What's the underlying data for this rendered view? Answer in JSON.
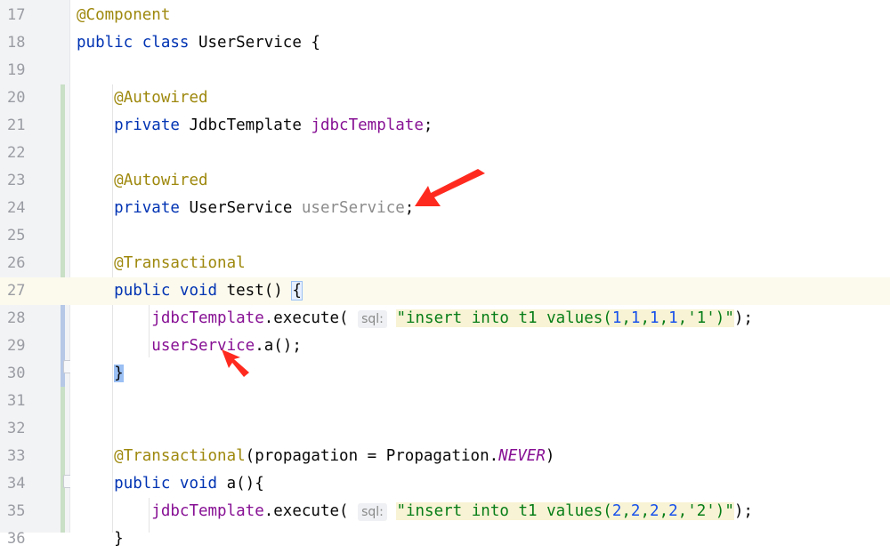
{
  "editor": {
    "lines": [
      {
        "n": "17",
        "parts": [
          {
            "t": "@Component",
            "c": "ann"
          }
        ]
      },
      {
        "n": "18",
        "parts": [
          {
            "t": "public",
            "c": "kw"
          },
          {
            "t": " "
          },
          {
            "t": "class",
            "c": "kw"
          },
          {
            "t": " UserService {"
          }
        ]
      },
      {
        "n": "19",
        "parts": []
      },
      {
        "n": "20",
        "parts": [
          {
            "t": "    "
          },
          {
            "t": "@Autowired",
            "c": "ann"
          }
        ]
      },
      {
        "n": "21",
        "parts": [
          {
            "t": "    "
          },
          {
            "t": "private",
            "c": "kw"
          },
          {
            "t": " JdbcTemplate "
          },
          {
            "t": "jdbcTemplate",
            "c": "fld"
          },
          {
            "t": ";"
          }
        ]
      },
      {
        "n": "22",
        "parts": []
      },
      {
        "n": "23",
        "parts": [
          {
            "t": "    "
          },
          {
            "t": "@Autowired",
            "c": "ann"
          }
        ]
      },
      {
        "n": "24",
        "parts": [
          {
            "t": "    "
          },
          {
            "t": "private",
            "c": "kw"
          },
          {
            "t": " UserService "
          },
          {
            "t": "userService",
            "c": "unused"
          },
          {
            "t": ";"
          }
        ]
      },
      {
        "n": "25",
        "parts": []
      },
      {
        "n": "26",
        "parts": [
          {
            "t": "    "
          },
          {
            "t": "@Transactional",
            "c": "ann"
          }
        ]
      },
      {
        "n": "27",
        "current": true,
        "parts": [
          {
            "t": "    "
          },
          {
            "t": "public",
            "c": "kw"
          },
          {
            "t": " "
          },
          {
            "t": "void",
            "c": "kw"
          },
          {
            "t": " test() "
          },
          {
            "t": "{",
            "c": "brace-open"
          }
        ]
      },
      {
        "n": "28",
        "parts": [
          {
            "t": "        "
          },
          {
            "t": "jdbcTemplate",
            "c": "fld"
          },
          {
            "t": ".execute( "
          },
          {
            "t": "sql:",
            "c": "hint"
          },
          {
            "t": " "
          },
          {
            "t": "\"",
            "c": "str"
          },
          {
            "t": "insert",
            "c": "str sk"
          },
          {
            "t": " ",
            "c": "str"
          },
          {
            "t": "into",
            "c": "str sk"
          },
          {
            "t": " t1 ",
            "c": "str"
          },
          {
            "t": "values",
            "c": "str sk"
          },
          {
            "t": "(",
            "c": "str"
          },
          {
            "t": "1",
            "c": "str num"
          },
          {
            "t": ",",
            "c": "str"
          },
          {
            "t": "1",
            "c": "str num"
          },
          {
            "t": ",",
            "c": "str"
          },
          {
            "t": "1",
            "c": "str num"
          },
          {
            "t": ",",
            "c": "str"
          },
          {
            "t": "1",
            "c": "str num"
          },
          {
            "t": ",'1')\"",
            "c": "str"
          },
          {
            "t": ");"
          }
        ]
      },
      {
        "n": "29",
        "parts": [
          {
            "t": "        "
          },
          {
            "t": "userService",
            "c": "fld"
          },
          {
            "t": ".a();"
          }
        ]
      },
      {
        "n": "30",
        "parts": [
          {
            "t": "    "
          },
          {
            "t": "}",
            "c": "brace"
          }
        ]
      },
      {
        "n": "31",
        "parts": []
      },
      {
        "n": "32",
        "parts": []
      },
      {
        "n": "33",
        "parts": [
          {
            "t": "    "
          },
          {
            "t": "@Transactional",
            "c": "ann"
          },
          {
            "t": "(propagation = Propagation."
          },
          {
            "t": "NEVER",
            "c": "const"
          },
          {
            "t": ")"
          }
        ]
      },
      {
        "n": "34",
        "parts": [
          {
            "t": "    "
          },
          {
            "t": "public",
            "c": "kw"
          },
          {
            "t": " "
          },
          {
            "t": "void",
            "c": "kw"
          },
          {
            "t": " a(){"
          }
        ]
      },
      {
        "n": "35",
        "parts": [
          {
            "t": "        "
          },
          {
            "t": "jdbcTemplate",
            "c": "fld"
          },
          {
            "t": ".execute( "
          },
          {
            "t": "sql:",
            "c": "hint"
          },
          {
            "t": " "
          },
          {
            "t": "\"",
            "c": "str"
          },
          {
            "t": "insert",
            "c": "str sk"
          },
          {
            "t": " ",
            "c": "str"
          },
          {
            "t": "into",
            "c": "str sk"
          },
          {
            "t": " t1 ",
            "c": "str"
          },
          {
            "t": "values",
            "c": "str sk"
          },
          {
            "t": "(",
            "c": "str"
          },
          {
            "t": "2",
            "c": "str num"
          },
          {
            "t": ",",
            "c": "str"
          },
          {
            "t": "2",
            "c": "str num"
          },
          {
            "t": ",",
            "c": "str"
          },
          {
            "t": "2",
            "c": "str num"
          },
          {
            "t": ",",
            "c": "str"
          },
          {
            "t": "2",
            "c": "str num"
          },
          {
            "t": ",'2')\"",
            "c": "str"
          },
          {
            "t": ");"
          }
        ]
      },
      {
        "n": "36",
        "parts": [
          {
            "t": "    "
          },
          {
            "t": "}"
          }
        ]
      }
    ]
  },
  "colors": {
    "annotation": "#9e880d",
    "keyword": "#0033b3",
    "field": "#871094",
    "string": "#067d17",
    "number": "#1750eb",
    "arrow": "#ff2a1f"
  }
}
